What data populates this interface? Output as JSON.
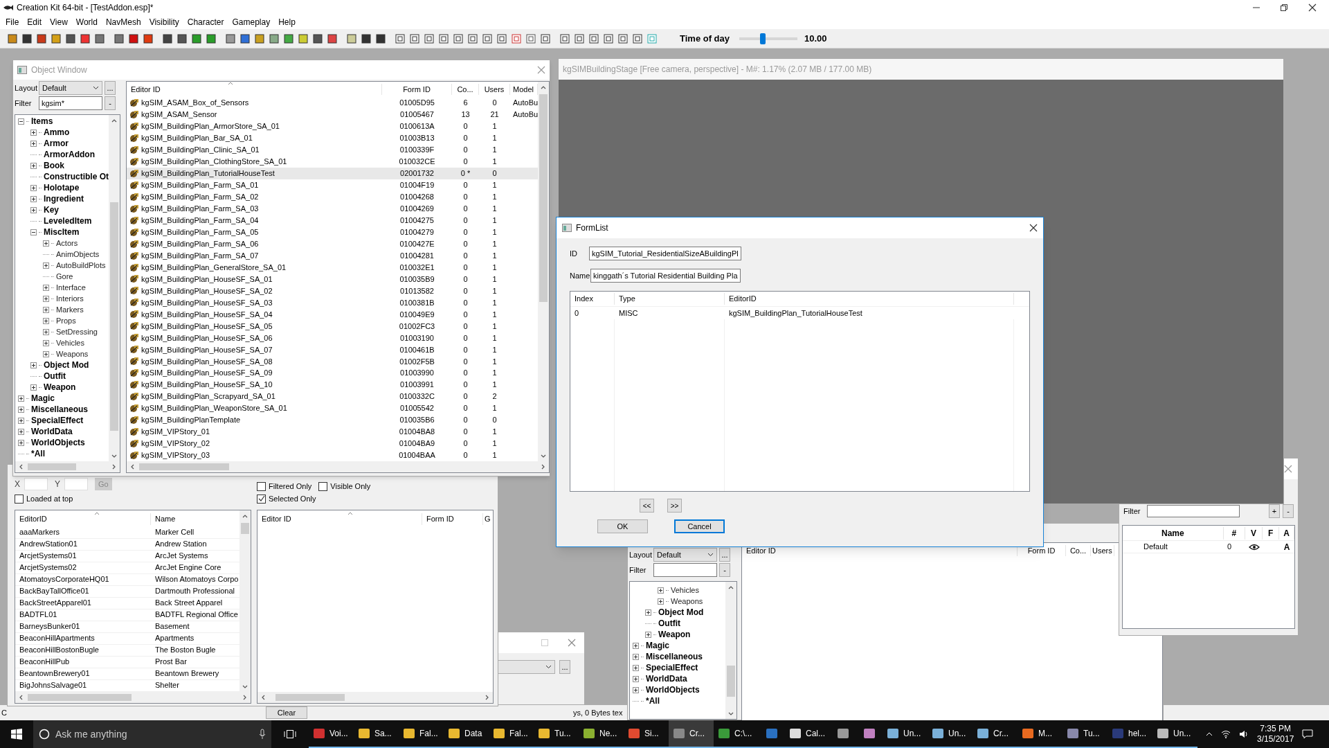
{
  "app": {
    "title": "Creation Kit 64-bit - [TestAddon.esp]*",
    "menu": [
      "File",
      "Edit",
      "View",
      "World",
      "NavMesh",
      "Visibility",
      "Character",
      "Gameplay",
      "Help"
    ]
  },
  "toolbar": {
    "time_label": "Time of day",
    "time_slider": {
      "level": 0.41
    },
    "time_value": "10.00"
  },
  "render_window": {
    "title": "kgSIMBuildingStage [Free camera, perspective] - M#: 1.17% (2.07 MB / 177.00 MB)"
  },
  "object_window": {
    "title": "Object Window",
    "layout_label": "Layout",
    "layout_value": "Default",
    "more_button": "...",
    "filter_label": "Filter",
    "filter_value": "kgsim*",
    "clear_filter_button": "-",
    "tree": [
      {
        "label": "Items",
        "kind": "branch",
        "expanded": true,
        "children": [
          {
            "label": "Ammo",
            "kind": "branch",
            "expanded": false
          },
          {
            "label": "Armor",
            "kind": "branch",
            "expanded": false
          },
          {
            "label": "ArmorAddon",
            "kind": "leaf"
          },
          {
            "label": "Book",
            "kind": "branch",
            "expanded": false
          },
          {
            "label": "Constructible Ot",
            "kind": "leaf"
          },
          {
            "label": "Holotape",
            "kind": "branch",
            "expanded": false
          },
          {
            "label": "Ingredient",
            "kind": "branch",
            "expanded": false
          },
          {
            "label": "Key",
            "kind": "branch",
            "expanded": false
          },
          {
            "label": "LeveledItem",
            "kind": "leaf"
          },
          {
            "label": "MiscItem",
            "kind": "branch",
            "expanded": true,
            "children": [
              {
                "label": "Actors",
                "kind": "branch",
                "expanded": false
              },
              {
                "label": "AnimObjects",
                "kind": "leaf"
              },
              {
                "label": "AutoBuildPlots",
                "kind": "branch",
                "expanded": false
              },
              {
                "label": "Gore",
                "kind": "leaf"
              },
              {
                "label": "Interface",
                "kind": "branch",
                "expanded": false
              },
              {
                "label": "Interiors",
                "kind": "branch",
                "expanded": false
              },
              {
                "label": "Markers",
                "kind": "branch",
                "expanded": false
              },
              {
                "label": "Props",
                "kind": "branch",
                "expanded": false
              },
              {
                "label": "SetDressing",
                "kind": "branch",
                "expanded": false
              },
              {
                "label": "Vehicles",
                "kind": "branch",
                "expanded": false
              },
              {
                "label": "Weapons",
                "kind": "branch",
                "expanded": false
              }
            ]
          },
          {
            "label": "Object Mod",
            "kind": "branch",
            "expanded": false
          },
          {
            "label": "Outfit",
            "kind": "leaf"
          },
          {
            "label": "Weapon",
            "kind": "branch",
            "expanded": false
          }
        ]
      },
      {
        "label": "Magic",
        "kind": "branch",
        "expanded": false
      },
      {
        "label": "Miscellaneous",
        "kind": "branch",
        "expanded": false
      },
      {
        "label": "SpecialEffect",
        "kind": "branch",
        "expanded": false
      },
      {
        "label": "WorldData",
        "kind": "branch",
        "expanded": false
      },
      {
        "label": "WorldObjects",
        "kind": "branch",
        "expanded": false
      },
      {
        "label": "*All",
        "kind": "leaf"
      }
    ],
    "columns": [
      "Editor ID",
      "Form ID",
      "Co...",
      "Users",
      "Model"
    ],
    "rows": [
      {
        "editor_id": "kgSIM_ASAM_Box_of_Sensors",
        "form_id": "01005D95",
        "count": "6",
        "users": "0",
        "model": "AutoBu",
        "selected": false
      },
      {
        "editor_id": "kgSIM_ASAM_Sensor",
        "form_id": "01005467",
        "count": "13",
        "users": "21",
        "model": "AutoBu",
        "selected": false
      },
      {
        "editor_id": "kgSIM_BuildingPlan_ArmorStore_SA_01",
        "form_id": "0100613A",
        "count": "0",
        "users": "1",
        "selected": false
      },
      {
        "editor_id": "kgSIM_BuildingPlan_Bar_SA_01",
        "form_id": "01003B13",
        "count": "0",
        "users": "1",
        "selected": false
      },
      {
        "editor_id": "kgSIM_BuildingPlan_Clinic_SA_01",
        "form_id": "0100339F",
        "count": "0",
        "users": "1",
        "selected": false
      },
      {
        "editor_id": "kgSIM_BuildingPlan_ClothingStore_SA_01",
        "form_id": "010032CE",
        "count": "0",
        "users": "1",
        "selected": false
      },
      {
        "editor_id": "kgSIM_BuildingPlan_TutorialHouseTest",
        "form_id": "02001732",
        "count": "0 *",
        "users": "0",
        "selected": true
      },
      {
        "editor_id": "kgSIM_BuildingPlan_Farm_SA_01",
        "form_id": "01004F19",
        "count": "0",
        "users": "1",
        "selected": false
      },
      {
        "editor_id": "kgSIM_BuildingPlan_Farm_SA_02",
        "form_id": "01004268",
        "count": "0",
        "users": "1",
        "selected": false
      },
      {
        "editor_id": "kgSIM_BuildingPlan_Farm_SA_03",
        "form_id": "01004269",
        "count": "0",
        "users": "1",
        "selected": false
      },
      {
        "editor_id": "kgSIM_BuildingPlan_Farm_SA_04",
        "form_id": "01004275",
        "count": "0",
        "users": "1",
        "selected": false
      },
      {
        "editor_id": "kgSIM_BuildingPlan_Farm_SA_05",
        "form_id": "01004279",
        "count": "0",
        "users": "1",
        "selected": false
      },
      {
        "editor_id": "kgSIM_BuildingPlan_Farm_SA_06",
        "form_id": "0100427E",
        "count": "0",
        "users": "1",
        "selected": false
      },
      {
        "editor_id": "kgSIM_BuildingPlan_Farm_SA_07",
        "form_id": "01004281",
        "count": "0",
        "users": "1",
        "selected": false
      },
      {
        "editor_id": "kgSIM_BuildingPlan_GeneralStore_SA_01",
        "form_id": "010032E1",
        "count": "0",
        "users": "1",
        "selected": false
      },
      {
        "editor_id": "kgSIM_BuildingPlan_HouseSF_SA_01",
        "form_id": "010035B9",
        "count": "0",
        "users": "1",
        "selected": false
      },
      {
        "editor_id": "kgSIM_BuildingPlan_HouseSF_SA_02",
        "form_id": "01013582",
        "count": "0",
        "users": "1",
        "selected": false
      },
      {
        "editor_id": "kgSIM_BuildingPlan_HouseSF_SA_03",
        "form_id": "0100381B",
        "count": "0",
        "users": "1",
        "selected": false
      },
      {
        "editor_id": "kgSIM_BuildingPlan_HouseSF_SA_04",
        "form_id": "010049E9",
        "count": "0",
        "users": "1",
        "selected": false
      },
      {
        "editor_id": "kgSIM_BuildingPlan_HouseSF_SA_05",
        "form_id": "01002FC3",
        "count": "0",
        "users": "1",
        "selected": false
      },
      {
        "editor_id": "kgSIM_BuildingPlan_HouseSF_SA_06",
        "form_id": "01003190",
        "count": "0",
        "users": "1",
        "selected": false
      },
      {
        "editor_id": "kgSIM_BuildingPlan_HouseSF_SA_07",
        "form_id": "0100461B",
        "count": "0",
        "users": "1",
        "selected": false
      },
      {
        "editor_id": "kgSIM_BuildingPlan_HouseSF_SA_08",
        "form_id": "01002F5B",
        "count": "0",
        "users": "1",
        "selected": false
      },
      {
        "editor_id": "kgSIM_BuildingPlan_HouseSF_SA_09",
        "form_id": "01003990",
        "count": "0",
        "users": "1",
        "selected": false
      },
      {
        "editor_id": "kgSIM_BuildingPlan_HouseSF_SA_10",
        "form_id": "01003991",
        "count": "0",
        "users": "1",
        "selected": false
      },
      {
        "editor_id": "kgSIM_BuildingPlan_Scrapyard_SA_01",
        "form_id": "0100332C",
        "count": "0",
        "users": "2",
        "selected": false
      },
      {
        "editor_id": "kgSIM_BuildingPlan_WeaponStore_SA_01",
        "form_id": "01005542",
        "count": "0",
        "users": "1",
        "selected": false
      },
      {
        "editor_id": "kgSIM_BuildingPlanTemplate",
        "form_id": "010035B6",
        "count": "0",
        "users": "0",
        "selected": false
      },
      {
        "editor_id": "kgSIM_VIPStory_01",
        "form_id": "01004BA8",
        "count": "0",
        "users": "1",
        "selected": false
      },
      {
        "editor_id": "kgSIM_VIPStory_02",
        "form_id": "01004BA9",
        "count": "0",
        "users": "1",
        "selected": false
      },
      {
        "editor_id": "kgSIM_VIPStory_03",
        "form_id": "01004BAA",
        "count": "0",
        "users": "1",
        "selected": false
      }
    ]
  },
  "cell_view": {
    "x_label": "X",
    "y_label": "Y",
    "go_button": "Go",
    "loaded_at_top": {
      "label": "Loaded at top",
      "checked": false
    },
    "filters": [
      {
        "label": "Filtered Only",
        "checked": false
      },
      {
        "label": "Visible Only",
        "checked": false
      },
      {
        "label": "Selected Only",
        "checked": true
      }
    ],
    "cell_columns": [
      "EditorID",
      "Name"
    ],
    "cells": [
      {
        "editor_id": "aaaMarkers",
        "name": "Marker Cell"
      },
      {
        "editor_id": "AndrewStation01",
        "name": "Andrew Station"
      },
      {
        "editor_id": "ArcjetSystems01",
        "name": "ArcJet Systems"
      },
      {
        "editor_id": "ArcjetSystems02",
        "name": "ArcJet Engine Core"
      },
      {
        "editor_id": "AtomatoysCorporateHQ01",
        "name": "Wilson Atomatoys Corpo"
      },
      {
        "editor_id": "BackBayTallOffice01",
        "name": "Dartmouth Professional"
      },
      {
        "editor_id": "BackStreetApparel01",
        "name": "Back Street Apparel"
      },
      {
        "editor_id": "BADTFL01",
        "name": "BADTFL Regional Office"
      },
      {
        "editor_id": "BarneysBunker01",
        "name": "Basement"
      },
      {
        "editor_id": "BeaconHillApartments",
        "name": "Apartments"
      },
      {
        "editor_id": "BeaconHillBostonBugle",
        "name": "The Boston Bugle"
      },
      {
        "editor_id": "BeaconHillPub",
        "name": "Prost Bar"
      },
      {
        "editor_id": "BeantownBrewery01",
        "name": "Beantown Brewery"
      },
      {
        "editor_id": "BigJohnsSalvage01",
        "name": "Shelter"
      }
    ],
    "ref_columns": [
      "Editor ID",
      "Form ID",
      "G"
    ],
    "clear_button": "Clear"
  },
  "small_window": {
    "more_button": "..."
  },
  "status_bar": {
    "segments": [
      "C",
      "ys, 0 Bytes tex"
    ]
  },
  "object_window_2": {
    "layout_label": "Layout",
    "layout_value": "Default",
    "more_button": "...",
    "filter_label": "Filter",
    "clear_filter_button": "-",
    "tree": [
      {
        "kind": "hidden",
        "children": [
          {
            "kind": "hidden",
            "children": [
              {
                "label": "Vehicles",
                "kind": "branch",
                "expanded": false
              },
              {
                "label": "Weapons",
                "kind": "branch",
                "expanded": false
              }
            ]
          },
          {
            "label": "Object Mod",
            "kind": "branch",
            "expanded": false
          },
          {
            "label": "Outfit",
            "kind": "leaf"
          },
          {
            "label": "Weapon",
            "kind": "branch",
            "expanded": false
          }
        ]
      },
      {
        "label": "Magic",
        "kind": "branch",
        "expanded": false
      },
      {
        "label": "Miscellaneous",
        "kind": "branch",
        "expanded": false
      },
      {
        "label": "SpecialEffect",
        "kind": "branch",
        "expanded": false
      },
      {
        "label": "WorldData",
        "kind": "branch",
        "expanded": false
      },
      {
        "label": "WorldObjects",
        "kind": "branch",
        "expanded": false
      },
      {
        "label": "*All",
        "kind": "leaf"
      }
    ],
    "columns": [
      "Editor ID",
      "Form ID",
      "Co...",
      "Users"
    ]
  },
  "layers_window": {
    "filter_label": "Filter",
    "add_button": "+",
    "remove_button": "-",
    "columns": [
      "Name",
      "#",
      "V",
      "F",
      "A"
    ],
    "rows": [
      {
        "name": "Default",
        "count": "0",
        "visible": true,
        "active": "A"
      }
    ]
  },
  "form_list": {
    "title": "FormList",
    "id_label": "ID",
    "id_value": "kgSIM_Tutorial_ResidentialSizeABuildingPl",
    "name_label": "Name",
    "name_value": "kinggath´s Tutorial Residential Building Pla",
    "columns": [
      "Index",
      "Type",
      "EditorID"
    ],
    "rows": [
      {
        "index": "0",
        "type": "MISC",
        "editor_id": "kgSIM_BuildingPlan_TutorialHouseTest"
      }
    ],
    "prev_button": "<<",
    "next_button": ">>",
    "ok_button": "OK",
    "cancel_button": "Cancel"
  },
  "taskbar": {
    "search_placeholder": "Ask me anything",
    "apps": [
      {
        "kind": "labeled",
        "label": "Voi...",
        "selected": false
      },
      {
        "kind": "labeled",
        "label": "Sa...",
        "selected": false
      },
      {
        "kind": "labeled",
        "label": "Fal...",
        "selected": false
      },
      {
        "kind": "labeled",
        "label": "Data",
        "selected": false
      },
      {
        "kind": "labeled",
        "label": "Fal...",
        "selected": false
      },
      {
        "kind": "labeled",
        "label": "Tu...",
        "selected": false
      },
      {
        "kind": "labeled",
        "label": "Ne...",
        "selected": false
      },
      {
        "kind": "labeled",
        "label": "Si...",
        "selected": false
      },
      {
        "kind": "labeled",
        "label": "Cr...",
        "selected": true
      },
      {
        "kind": "labeled",
        "label": "C:\\...",
        "selected": false
      },
      {
        "kind": "icon",
        "selected": false
      },
      {
        "kind": "labeled",
        "label": "Cal...",
        "selected": false
      },
      {
        "kind": "icon",
        "selected": false
      },
      {
        "kind": "icon",
        "selected": false
      },
      {
        "kind": "labeled",
        "label": "Un...",
        "selected": false
      },
      {
        "kind": "labeled",
        "label": "Un...",
        "selected": false
      },
      {
        "kind": "labeled",
        "label": "Cr...",
        "selected": false
      },
      {
        "kind": "labeled",
        "label": "M...",
        "selected": false
      },
      {
        "kind": "labeled",
        "label": "Tu...",
        "selected": false
      },
      {
        "kind": "labeled",
        "label": "hel...",
        "selected": false
      },
      {
        "kind": "labeled",
        "label": "Un...",
        "selected": false
      }
    ],
    "time": "7:35 PM",
    "date": "3/15/2017"
  }
}
